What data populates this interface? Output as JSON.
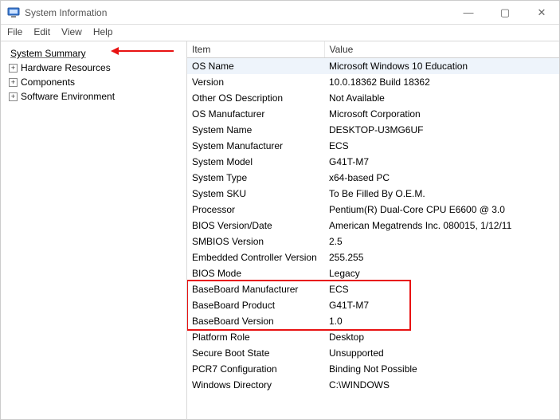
{
  "window": {
    "title": "System Information",
    "controls": {
      "minimize": "—",
      "maximize": "▢",
      "close": "✕"
    }
  },
  "menu": {
    "file": "File",
    "edit": "Edit",
    "view": "View",
    "help": "Help"
  },
  "tree": {
    "root": "System Summary",
    "items": [
      {
        "label": "Hardware Resources"
      },
      {
        "label": "Components"
      },
      {
        "label": "Software Environment"
      }
    ]
  },
  "grid": {
    "headers": {
      "item": "Item",
      "value": "Value"
    },
    "rows": [
      {
        "item": "OS Name",
        "value": "Microsoft Windows 10 Education",
        "selected": true
      },
      {
        "item": "Version",
        "value": "10.0.18362 Build 18362"
      },
      {
        "item": "Other OS Description",
        "value": "Not Available"
      },
      {
        "item": "OS Manufacturer",
        "value": "Microsoft Corporation"
      },
      {
        "item": "System Name",
        "value": "DESKTOP-U3MG6UF"
      },
      {
        "item": "System Manufacturer",
        "value": "ECS"
      },
      {
        "item": "System Model",
        "value": "G41T-M7"
      },
      {
        "item": "System Type",
        "value": "x64-based PC"
      },
      {
        "item": "System SKU",
        "value": "To Be Filled By O.E.M."
      },
      {
        "item": "Processor",
        "value": "Pentium(R) Dual-Core  CPU      E6600  @ 3.0"
      },
      {
        "item": "BIOS Version/Date",
        "value": "American Megatrends Inc. 080015, 1/12/11"
      },
      {
        "item": "SMBIOS Version",
        "value": "2.5"
      },
      {
        "item": "Embedded Controller Version",
        "value": "255.255"
      },
      {
        "item": "BIOS Mode",
        "value": "Legacy"
      },
      {
        "item": "BaseBoard Manufacturer",
        "value": "ECS",
        "highlighted": true
      },
      {
        "item": "BaseBoard Product",
        "value": "G41T-M7",
        "highlighted": true
      },
      {
        "item": "BaseBoard Version",
        "value": "1.0",
        "highlighted": true
      },
      {
        "item": "Platform Role",
        "value": "Desktop"
      },
      {
        "item": "Secure Boot State",
        "value": "Unsupported"
      },
      {
        "item": "PCR7 Configuration",
        "value": "Binding Not Possible"
      },
      {
        "item": "Windows Directory",
        "value": "C:\\WINDOWS"
      }
    ]
  }
}
